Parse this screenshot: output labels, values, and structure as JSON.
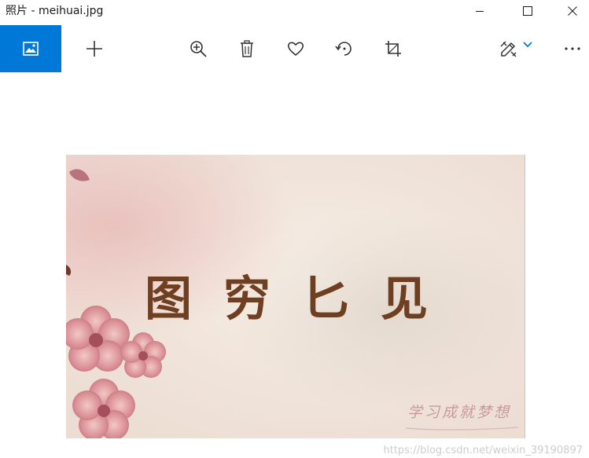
{
  "window": {
    "title": "照片 - meihuai.jpg"
  },
  "toolbar": {
    "gallery_icon": "gallery-icon",
    "add_icon": "plus-icon",
    "zoom_icon": "zoom-in-icon",
    "delete_icon": "trash-icon",
    "favorite_icon": "heart-icon",
    "rotate_icon": "rotate-icon",
    "crop_icon": "crop-icon",
    "edit_icon": "edit-draw-icon",
    "more_icon": "more-icon"
  },
  "colors": {
    "accent": "#0078d7",
    "icon": "#333333",
    "caption": "#6f3f22",
    "blossom": "#d8898f"
  },
  "photo": {
    "caption": "图穷匕见",
    "subcaption": "学习成就梦想"
  },
  "watermark": "https://blog.csdn.net/weixin_39190897"
}
